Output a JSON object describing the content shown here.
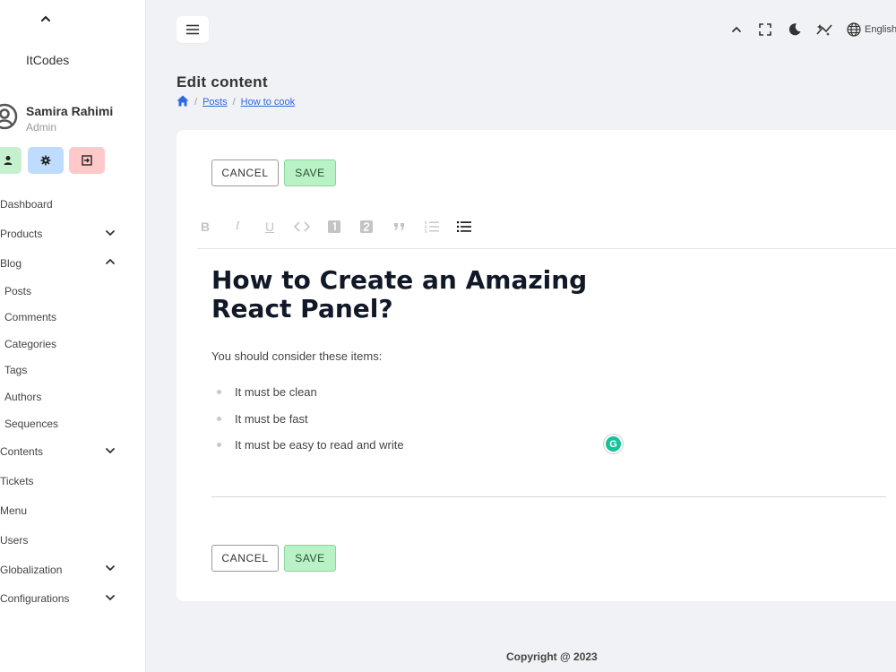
{
  "sidebar": {
    "brand": "ItCodes",
    "user": {
      "name": "Samira Rahimi",
      "role": "Admin"
    },
    "menu": [
      {
        "label": "Dashboard"
      },
      {
        "label": "Products"
      },
      {
        "label": "Blog"
      },
      {
        "label": "Posts"
      },
      {
        "label": "Comments"
      },
      {
        "label": "Categories"
      },
      {
        "label": "Tags"
      },
      {
        "label": "Authors"
      },
      {
        "label": "Sequences"
      },
      {
        "label": "Contents"
      },
      {
        "label": "Tickets"
      },
      {
        "label": "Menu"
      },
      {
        "label": "Users"
      },
      {
        "label": "Globalization"
      },
      {
        "label": "Configurations"
      }
    ]
  },
  "topbar": {
    "language": "English"
  },
  "page": {
    "title": "Edit content",
    "breadcrumb": [
      "Posts",
      "How to cook"
    ]
  },
  "editor": {
    "cancel_label": "CANCEL",
    "save_label": "SAVE",
    "heading": "How to Create an Amazing React Panel?",
    "intro": "You should consider these items:",
    "items": [
      "It must be clean",
      "It must be fast",
      "It must be easy to read and write"
    ]
  },
  "footer": {
    "copyright": "Copyright @ 2023"
  },
  "colors": {
    "save": "#b9f2c5",
    "accent": "#2f67e0",
    "quick_user": "#c6f1cf",
    "quick_settings": "#bfdcff",
    "quick_logout": "#ffc9c9"
  }
}
